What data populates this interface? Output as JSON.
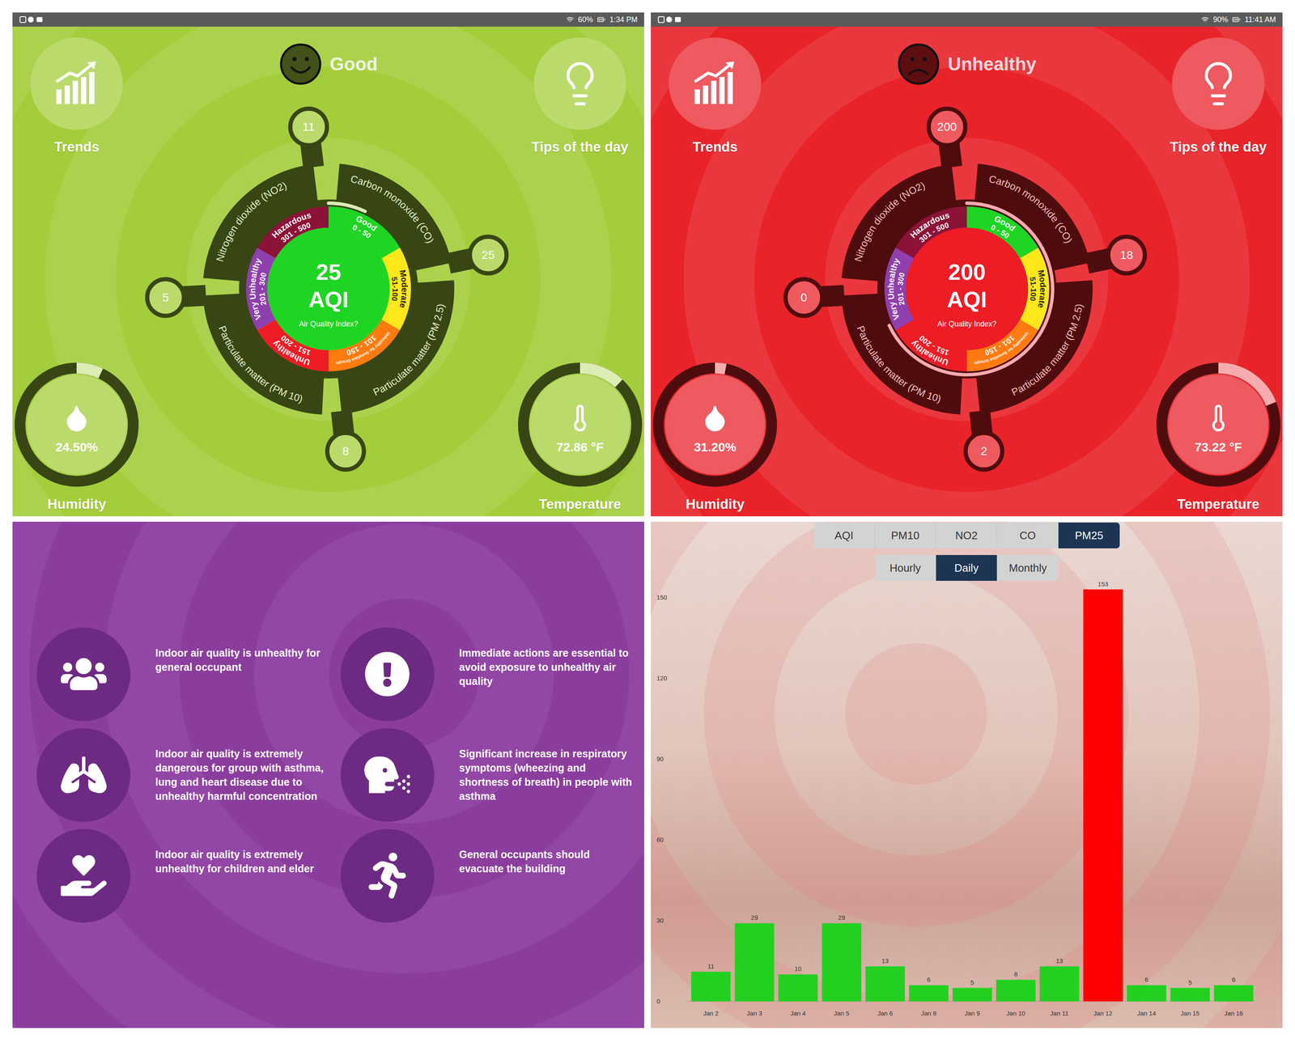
{
  "screens": [
    {
      "status_bar": {
        "battery": "60%",
        "time": "1:34 PM"
      },
      "color": "#a4cd3b",
      "mood": "happy",
      "status": "Good",
      "aqi": "25",
      "aqi_unit": "AQI",
      "aqi_caption": "Air Quality Index?",
      "indicator_level": 0.07,
      "bands": [
        {
          "name": "Good",
          "range": "0 - 50",
          "color": "#1fd523",
          "selected": true
        },
        {
          "name": "Moderate",
          "range": "51-100",
          "color": "#ffe81a",
          "selected": false
        },
        {
          "name": "Unhealthy for Sensitive Groups",
          "range": "101 - 150",
          "color": "#ff7b0f",
          "selected": false
        },
        {
          "name": "Unhealthy",
          "range": "151 - 200",
          "color": "#ee1c25",
          "selected": false
        },
        {
          "name": "Very Unhealthy",
          "range": "201 - 300",
          "color": "#8f3fae",
          "selected": false
        },
        {
          "name": "Hazardous",
          "range": "301 - 500",
          "color": "#8c1238",
          "selected": false
        }
      ],
      "pollutants": [
        {
          "name": "Nitrogen dioxide (NO2)",
          "value": "11"
        },
        {
          "name": "Carbon monoxide (CO)",
          "value": "25"
        },
        {
          "name": "Particulate matter (PM 2.5)",
          "value": "8"
        },
        {
          "name": "Particulate matter (PM 10)",
          "value": "5"
        }
      ],
      "trends": "Trends",
      "tips": "Tips of the day",
      "humidity": {
        "label": "Humidity",
        "value": "24.50%",
        "level": 0.07
      },
      "temperature": {
        "label": "Temperature",
        "value": "72.86 °F",
        "level": 0.12
      }
    },
    {
      "status_bar": {
        "battery": "90%",
        "time": "11:41 AM"
      },
      "color": "#e8232a",
      "mood": "sad",
      "status": "Unhealthy",
      "aqi": "200",
      "aqi_unit": "AQI",
      "aqi_caption": "Air Quality Index?",
      "indicator_level": 0.68,
      "bands": [
        {
          "name": "Good",
          "range": "0 - 50",
          "color": "#1fd523",
          "selected": false
        },
        {
          "name": "Moderate",
          "range": "51-100",
          "color": "#ffe81a",
          "selected": false
        },
        {
          "name": "Unhealthy for Sensitive Groups",
          "range": "101 - 150",
          "color": "#ff7b0f",
          "selected": false
        },
        {
          "name": "Unhealthy",
          "range": "151 - 200",
          "color": "#ee1c25",
          "selected": true
        },
        {
          "name": "Very Unhealthy",
          "range": "201 - 300",
          "color": "#8f3fae",
          "selected": false
        },
        {
          "name": "Hazardous",
          "range": "301 - 500",
          "color": "#8c1238",
          "selected": false
        }
      ],
      "pollutants": [
        {
          "name": "Nitrogen dioxide (NO2)",
          "value": "200"
        },
        {
          "name": "Carbon monoxide (CO)",
          "value": "18"
        },
        {
          "name": "Particulate matter (PM 2.5)",
          "value": "2"
        },
        {
          "name": "Particulate matter (PM 10)",
          "value": "0"
        }
      ],
      "trends": "Trends",
      "tips": "Tips of the day",
      "humidity": {
        "label": "Humidity",
        "value": "31.20%",
        "level": 0.03
      },
      "temperature": {
        "label": "Temperature",
        "value": "73.22 °F",
        "level": 0.19
      }
    }
  ],
  "advice": [
    "Indoor air quality is unhealthy for general occupant",
    "Immediate actions are essential to avoid exposure to unhealthy air quality",
    "Indoor air quality is extremely dangerous for group with asthma, lung and heart disease due to unhealthy harmful concentration",
    "Significant increase in respiratory symptoms (wheezing and shortness of breath) in people with asthma",
    "Indoor air quality is extremely unhealthy for children and elder",
    "General occupants should evacuate the building"
  ],
  "chart": {
    "metric_tabs": [
      {
        "label": "AQI",
        "selected": false
      },
      {
        "label": "PM10",
        "selected": false
      },
      {
        "label": "NO2",
        "selected": false
      },
      {
        "label": "CO",
        "selected": false
      },
      {
        "label": "PM25",
        "selected": true
      }
    ],
    "period_tabs": [
      {
        "label": "Hourly",
        "selected": false
      },
      {
        "label": "Daily",
        "selected": true
      },
      {
        "label": "Monthly",
        "selected": false
      }
    ],
    "y_ticks": [
      "0",
      "30",
      "60",
      "90",
      "120",
      "150"
    ],
    "categories": [
      "Jan 2",
      "Jan 3",
      "Jan 4",
      "Jan 5",
      "Jan 6",
      "Jan 8",
      "Jan 9",
      "Jan 10",
      "Jan 11",
      "Jan 12",
      "Jan 14",
      "Jan 15",
      "Jan 16"
    ],
    "series": [
      {
        "values": [
          11,
          29,
          10,
          29,
          13,
          6,
          5,
          8,
          13,
          153,
          6,
          5,
          6
        ],
        "value_labels": [
          "11",
          "29",
          "10",
          "29",
          "13",
          "6",
          "5",
          "8",
          "13",
          "153",
          "6",
          "5",
          "6"
        ],
        "colors": [
          "#22d11f",
          "#22d11f",
          "#22d11f",
          "#22d11f",
          "#22d11f",
          "#22d11f",
          "#22d11f",
          "#22d11f",
          "#22d11f",
          "#ff0000",
          "#22d11f",
          "#22d11f",
          "#22d11f"
        ]
      }
    ]
  }
}
